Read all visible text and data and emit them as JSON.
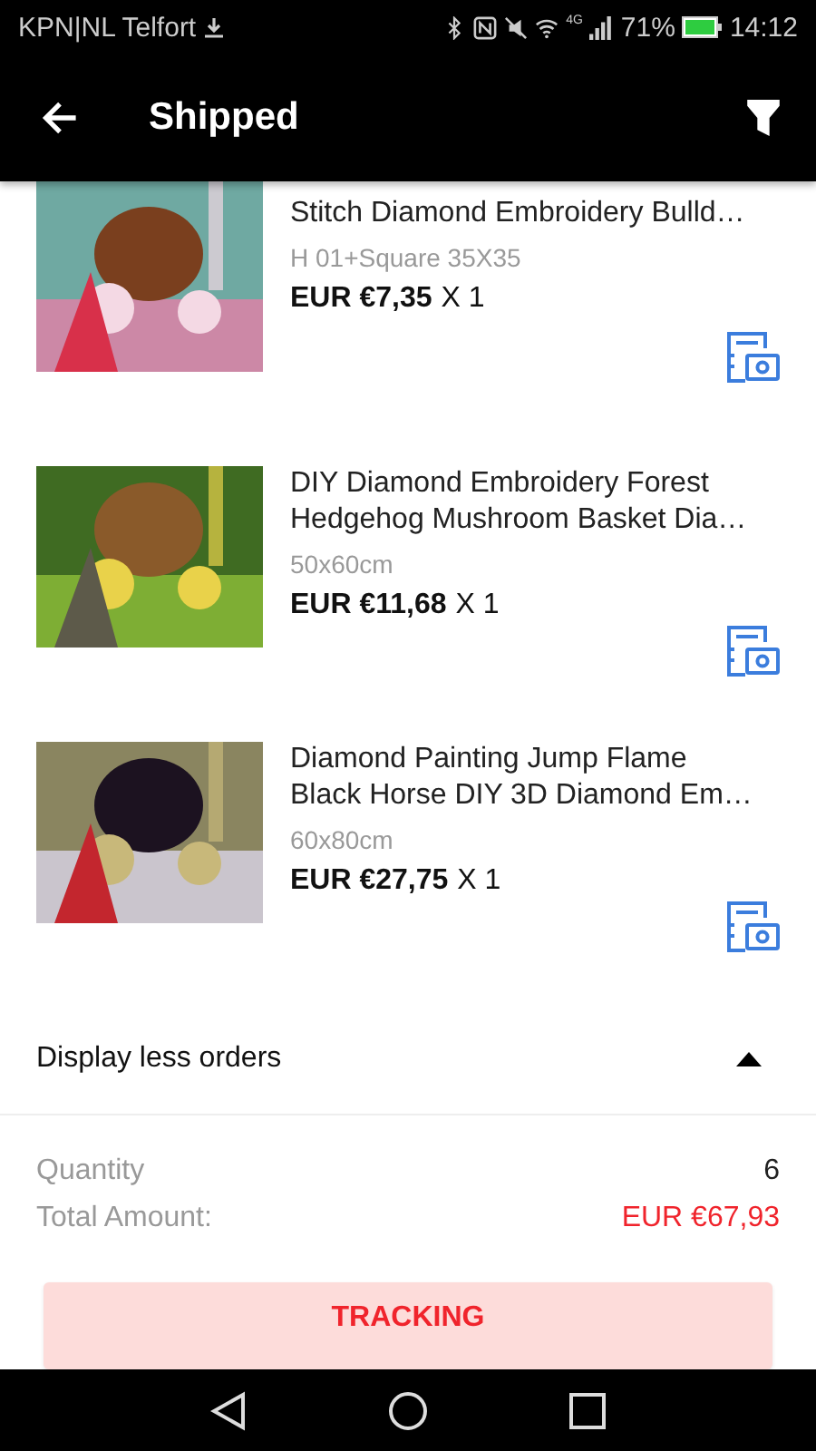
{
  "status_bar": {
    "carrier": "KPN|NL Telfort",
    "network": "4G",
    "battery": "71%",
    "time": "14:12"
  },
  "app_bar": {
    "title": "Shipped"
  },
  "items": [
    {
      "title": "Stitch Diamond Embroidery Bulld…",
      "variant": "H 01+Square 35X35",
      "price": "EUR €7,35",
      "quantity": "X 1"
    },
    {
      "title": "DIY Diamond Embroidery Forest Hedgehog Mushroom Basket Dia…",
      "variant": "50x60cm",
      "price": "EUR €11,68",
      "quantity": "X 1"
    },
    {
      "title": "Diamond Painting Jump Flame Black Horse DIY 3D Diamond Em…",
      "variant": "60x80cm",
      "price": "EUR €27,75",
      "quantity": "X 1"
    }
  ],
  "toggle": {
    "label": "Display less orders",
    "expanded": true
  },
  "summary": [
    {
      "label": "Quantity",
      "value": "6",
      "kind": "plain"
    },
    {
      "label": "Total Amount:",
      "value": "EUR €67,93",
      "kind": "total"
    }
  ],
  "button": "TRACKING"
}
